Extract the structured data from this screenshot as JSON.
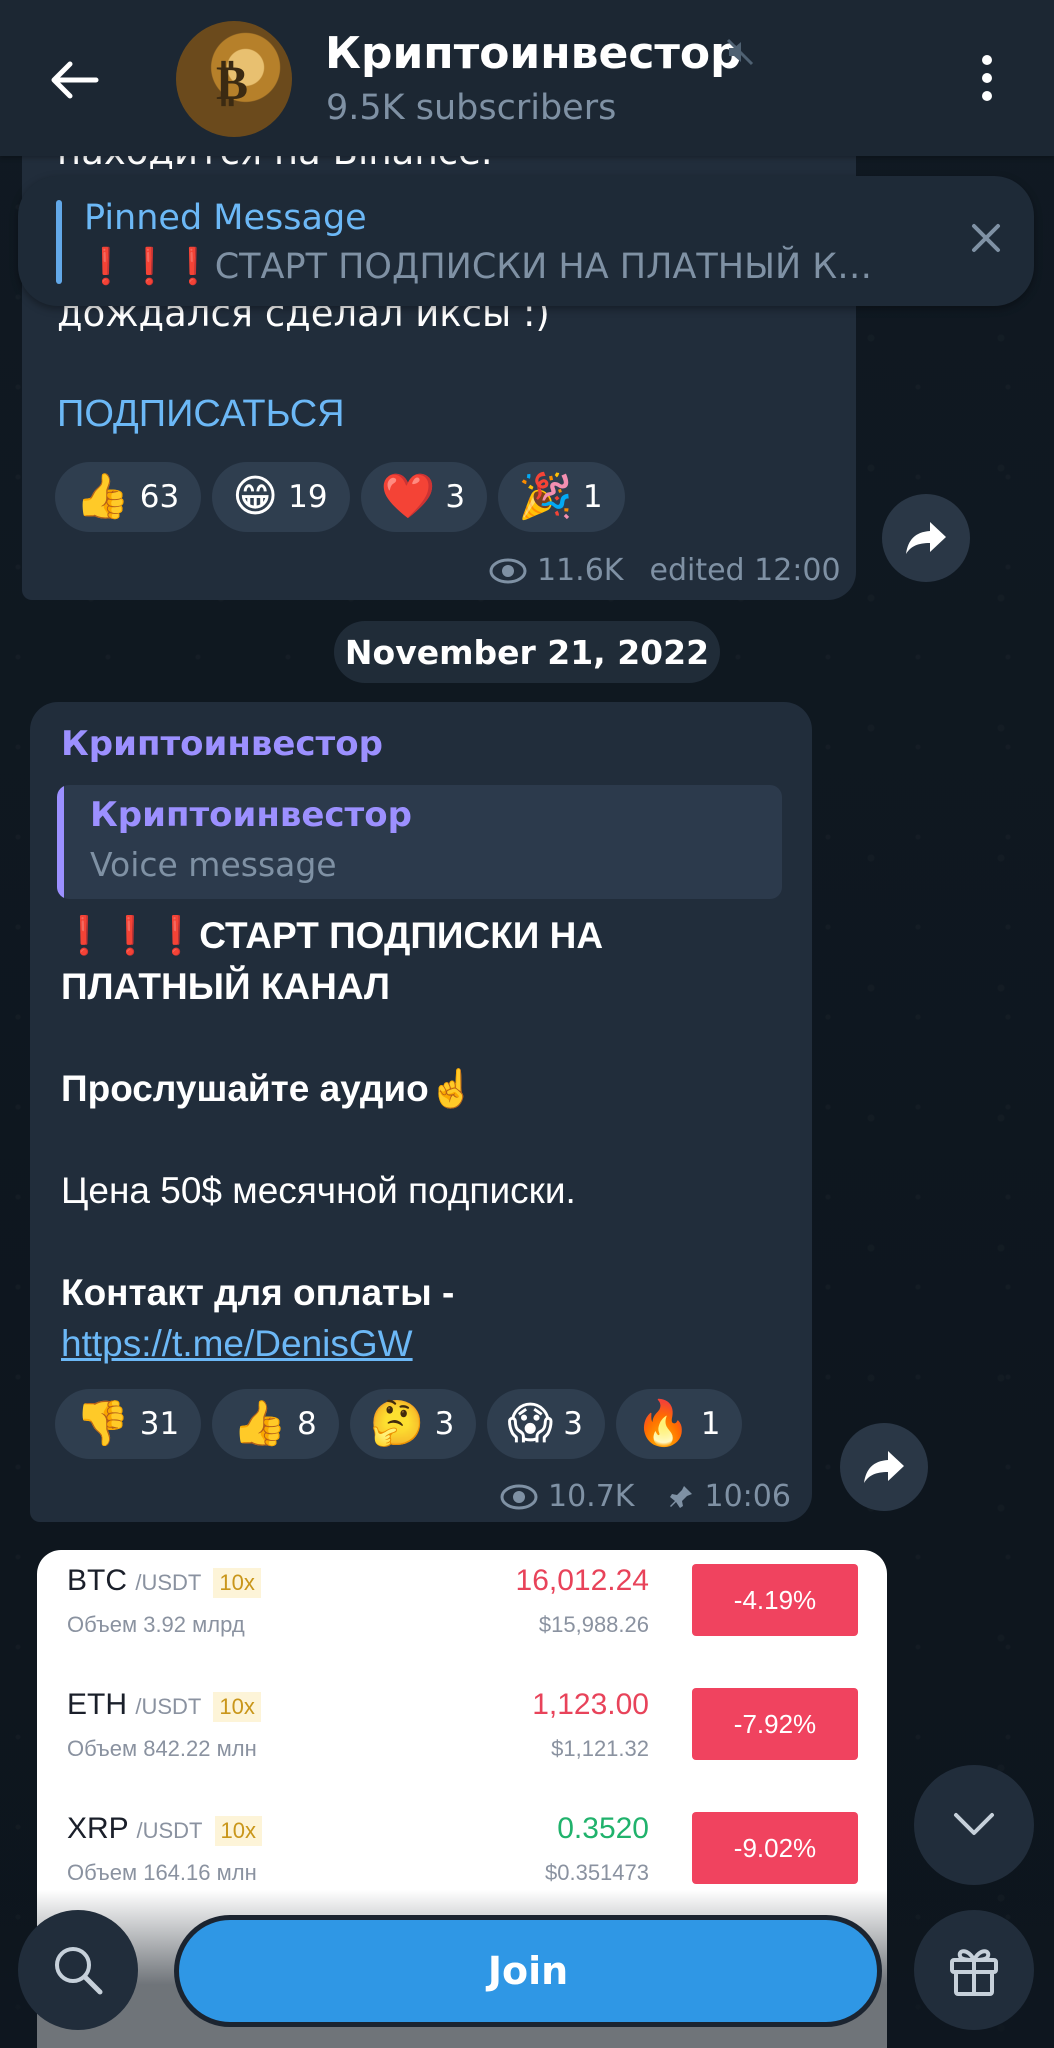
{
  "header": {
    "channel_name": "Криптоинвестор",
    "subscribers": "9.5K subscribers",
    "back_icon": "arrow-left-icon",
    "mute_icon": "muted-speaker-icon",
    "menu_icon": "vertical-dots-icon"
  },
  "pinned": {
    "title": "Pinned Message",
    "text": "❗❗❗СТАРТ ПОДПИСКИ НА ПЛАТНЫЙ К…",
    "close_icon": "close-icon"
  },
  "message_prev": {
    "cut_top": "находится на Binance.",
    "cut_mid": "дождался сделал иксы :)",
    "link": "ПОДПИСАТЬСЯ",
    "reactions": [
      {
        "emoji": "👍",
        "count": "63"
      },
      {
        "emoji": "😁",
        "count": "19"
      },
      {
        "emoji": "❤️",
        "count": "3"
      },
      {
        "emoji": "🎉",
        "count": "1"
      }
    ],
    "views": "11.6K",
    "time": "edited 12:00"
  },
  "date_separator": "November 21, 2022",
  "message_main": {
    "author": "Криптоинвестор",
    "reply_name": "Криптоинвестор",
    "reply_text": "Voice message",
    "line1": "❗❗❗СТАРТ ПОДПИСКИ НА ПЛАТНЫЙ КАНАЛ",
    "line2": "Прослушайте аудио☝️",
    "line3": "Цена 50$ месячной подписки.",
    "line4_label": "Контакт для оплаты - ",
    "line4_link": "https://t.me/DenisGW",
    "reactions": [
      {
        "emoji": "👎",
        "count": "31"
      },
      {
        "emoji": "👍",
        "count": "8"
      },
      {
        "emoji": "🤔",
        "count": "3"
      },
      {
        "emoji": "😱",
        "count": "3"
      },
      {
        "emoji": "🔥",
        "count": "1"
      }
    ],
    "views": "10.7K",
    "time": "10:06"
  },
  "photo": {
    "rows": [
      {
        "sym": "BTC",
        "pair": "/USDT",
        "lev": "10x",
        "vol": "Объем 3.92 млрд",
        "price": "16,012.24",
        "price_color": "#e8435a",
        "usd": "$15,988.26",
        "change": "-4.19%"
      },
      {
        "sym": "ETH",
        "pair": "/USDT",
        "lev": "10x",
        "vol": "Объем 842.22 млн",
        "price": "1,123.00",
        "price_color": "#e8435a",
        "usd": "$1,121.32",
        "change": "-7.92%"
      },
      {
        "sym": "XRP",
        "pair": "/USDT",
        "lev": "10x",
        "vol": "Объем 164.16 млн",
        "price": "0.3520",
        "price_color": "#20b26c",
        "usd": "$0.351473",
        "change": "-9.02%"
      }
    ]
  },
  "bottom": {
    "join_label": "Join",
    "search_icon": "search-icon",
    "gift_icon": "gift-icon",
    "scroll_icon": "chevron-down-icon"
  }
}
